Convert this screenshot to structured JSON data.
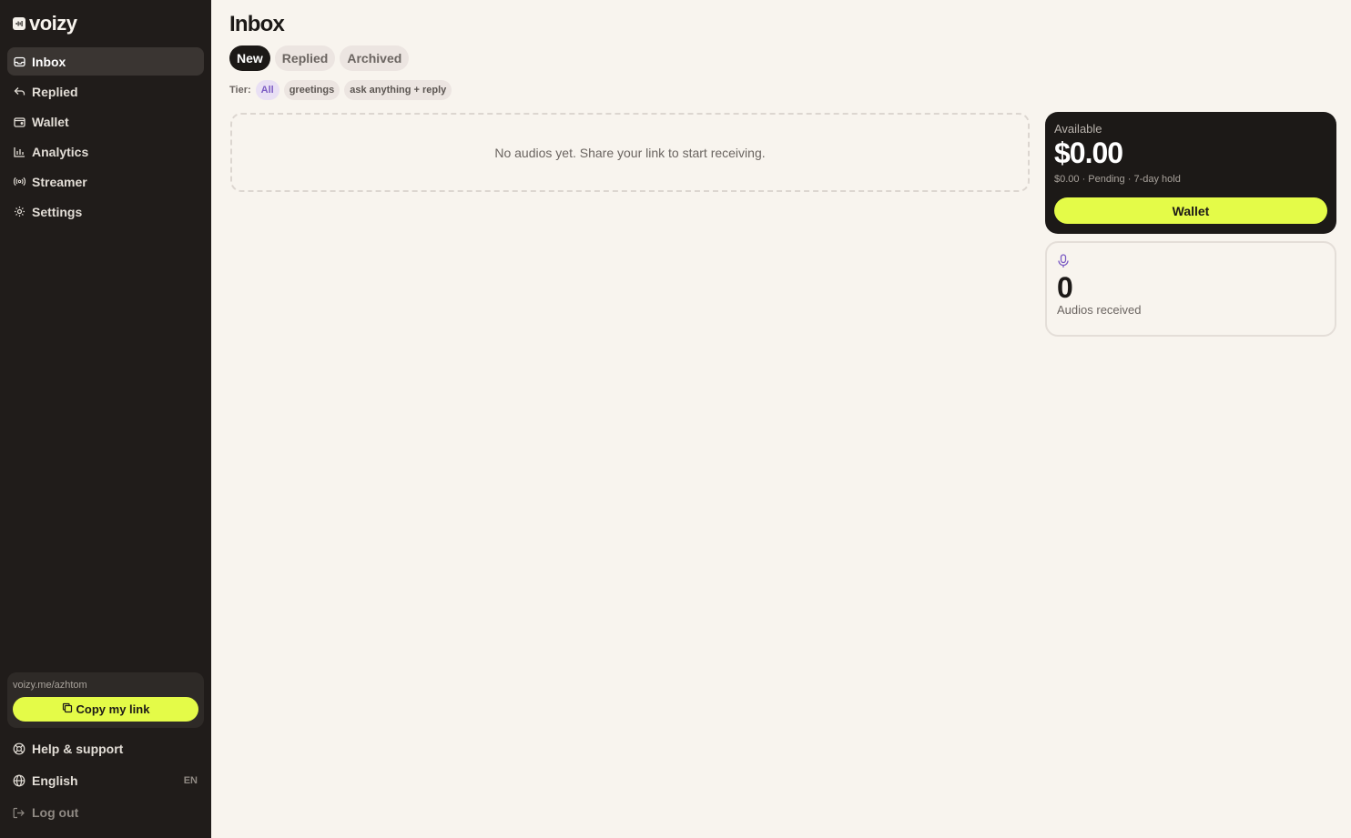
{
  "brand": {
    "name": "voizy"
  },
  "sidebar": {
    "items": [
      {
        "label": "Inbox",
        "icon": "inbox-icon",
        "active": true
      },
      {
        "label": "Replied",
        "icon": "reply-icon",
        "active": false
      },
      {
        "label": "Wallet",
        "icon": "wallet-icon",
        "active": false
      },
      {
        "label": "Analytics",
        "icon": "bar-chart-icon",
        "active": false
      },
      {
        "label": "Streamer",
        "icon": "broadcast-icon",
        "active": false
      },
      {
        "label": "Settings",
        "icon": "gear-icon",
        "active": false
      }
    ],
    "link_url": "voizy.me/azhtom",
    "copy_label": "Copy my link",
    "help_label": "Help & support",
    "language_label": "English",
    "language_code": "EN",
    "logout_label": "Log out"
  },
  "main": {
    "title": "Inbox",
    "tabs": [
      {
        "label": "New",
        "active": true
      },
      {
        "label": "Replied",
        "active": false
      },
      {
        "label": "Archived",
        "active": false
      }
    ],
    "tier_label": "Tier:",
    "tiers": [
      {
        "label": "All",
        "active": true
      },
      {
        "label": "greetings",
        "active": false
      },
      {
        "label": "ask anything + reply",
        "active": false
      }
    ],
    "empty_message": "No audios yet. Share your link to start receiving."
  },
  "wallet_card": {
    "available_label": "Available",
    "amount": "$0.00",
    "pending_text": "$0.00 · Pending · 7-day hold",
    "button_label": "Wallet"
  },
  "stats_card": {
    "icon": "microphone-icon",
    "count": "0",
    "label": "Audios received"
  },
  "colors": {
    "sidebar_bg": "#201c1a",
    "page_bg": "#f8f4ee",
    "accent": "#e4fb48",
    "tier_active": "#7c5cc4"
  }
}
